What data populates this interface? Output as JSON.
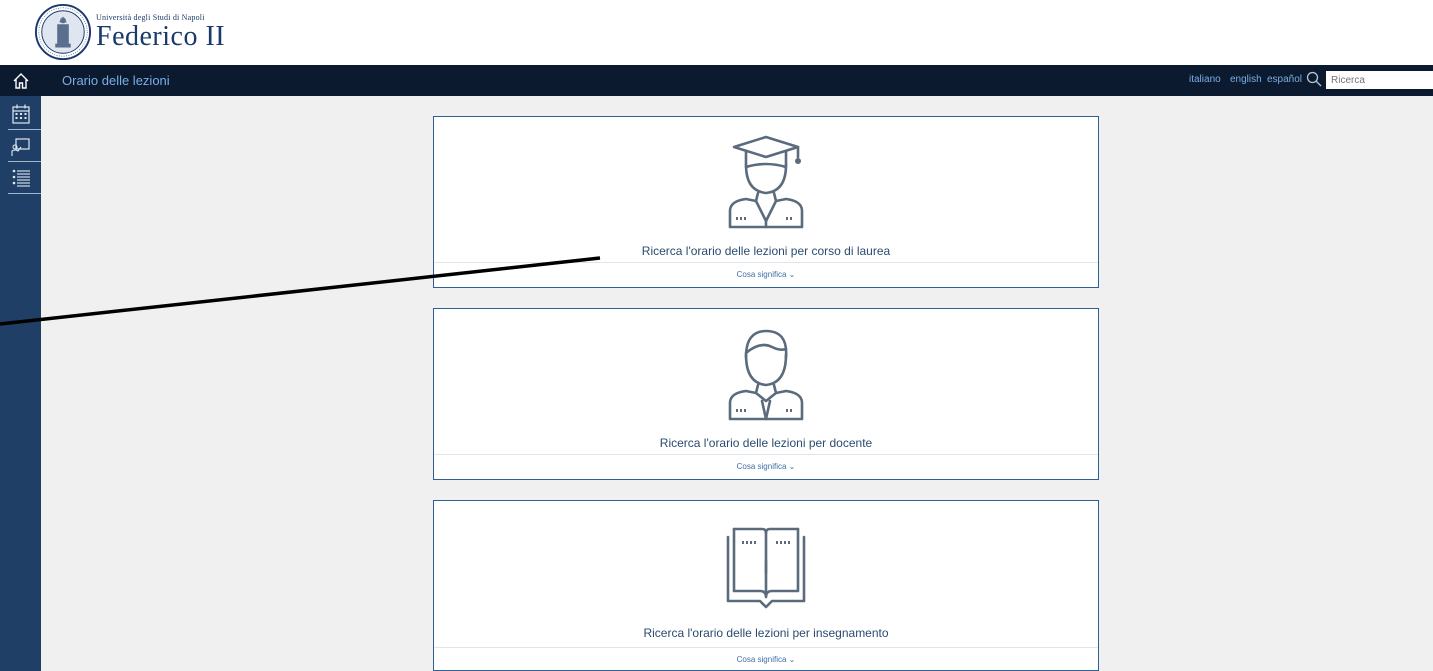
{
  "header": {
    "logo_small": "Università degli Studi di Napoli",
    "logo_big": "Federico II"
  },
  "topbar": {
    "title": "Orario delle lezioni",
    "languages": [
      "italiano",
      "english",
      "español"
    ],
    "search_placeholder": "Ricerca"
  },
  "sidebar": {
    "items": [
      {
        "icon": "home-icon"
      },
      {
        "icon": "calendar-icon"
      },
      {
        "icon": "classroom-icon"
      },
      {
        "icon": "list-icon"
      }
    ]
  },
  "cards": [
    {
      "icon": "graduate-icon",
      "label": "Ricerca l'orario delle lezioni per corso di laurea",
      "more": "Cosa significa ⌄"
    },
    {
      "icon": "teacher-icon",
      "label": "Ricerca l'orario delle lezioni per docente",
      "more": "Cosa significa ⌄"
    },
    {
      "icon": "book-icon",
      "label": "Ricerca l'orario delle lezioni per insegnamento",
      "more": "Cosa significa ⌄"
    }
  ],
  "colors": {
    "topbar": "#0b1a2e",
    "sidebar": "#1f3f66",
    "card_border": "#2f5f94",
    "accent_text": "#7aaee6",
    "background": "#f0f0f0"
  }
}
